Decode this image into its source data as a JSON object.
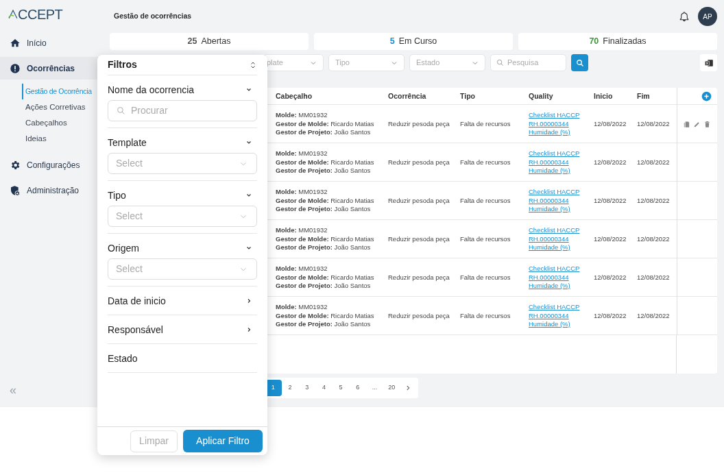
{
  "logo": "CCEPT",
  "sidebar": {
    "items": [
      {
        "label": "Início",
        "selected": false
      },
      {
        "label": "Ocorrências",
        "selected": true,
        "children": [
          {
            "label": "Gestão de Ocorrência",
            "selected": true
          },
          {
            "label": "Ações Corretivas",
            "selected": false
          },
          {
            "label": "Cabeçalhos",
            "selected": false
          },
          {
            "label": "Ideias",
            "selected": false
          }
        ]
      },
      {
        "label": "Configurações",
        "selected": false
      },
      {
        "label": "Administração",
        "selected": false
      }
    ],
    "collapse": "«"
  },
  "header": {
    "title": "Gestão de ocorrências",
    "avatar": "AP"
  },
  "status_cards": [
    {
      "count": "25",
      "label": "Abertas",
      "color": "#555555"
    },
    {
      "count": "5",
      "label": "Em Curso",
      "color": "#1a8fd0"
    },
    {
      "count": "70",
      "label": "Finalizadas",
      "color": "#3a9a3a"
    }
  ],
  "filter_bar": {
    "selects": [
      "plate",
      "Tipo",
      "Estado"
    ],
    "search_placeholder": "Pesquisa"
  },
  "table": {
    "columns": [
      "Cabeçalho",
      "Ocorrência",
      "Tipo",
      "Quality",
      "Inicio",
      "Fim"
    ],
    "rows": [
      {
        "header_lines": [
          "**Molde:** MM01932",
          "**Gestor de Molde:** Ricardo Matias",
          "**Gestor de Projeto:** João Santos"
        ],
        "occurrence": "Reduzir pesoda peça",
        "type": "Falta de recursos",
        "quality": [
          "Checklist HACCP",
          "RH.00000344",
          "Humidade (%)"
        ],
        "start": "12/08/2022",
        "end": "12/08/2022",
        "show_actions": true
      },
      {
        "header_lines": [
          "**Molde:** MM01932",
          "**Gestor de Molde:** Ricardo Matias",
          "**Gestor de Projeto:** João Santos"
        ],
        "occurrence": "Reduzir pesoda peça",
        "type": "Falta de recursos",
        "quality": [
          "Checklist HACCP",
          "RH.00000344",
          "Humidade (%)"
        ],
        "start": "12/08/2022",
        "end": "12/08/2022",
        "show_actions": false
      },
      {
        "header_lines": [
          "**Molde:** MM01932",
          "**Gestor de Molde:** Ricardo Matias",
          "**Gestor de Projeto:** João Santos"
        ],
        "occurrence": "Reduzir pesoda peça",
        "type": "Falta de recursos",
        "quality": [
          "Checklist HACCP",
          "RH.00000344",
          "Humidade (%)"
        ],
        "start": "12/08/2022",
        "end": "12/08/2022",
        "show_actions": false
      },
      {
        "header_lines": [
          "**Molde:** MM01932",
          "**Gestor de Molde:** Ricardo Matias",
          "**Gestor de Projeto:** João Santos"
        ],
        "occurrence": "Reduzir pesoda peça",
        "type": "Falta de recursos",
        "quality": [
          "Checklist HACCP",
          "RH.00000344",
          "Humidade (%)"
        ],
        "start": "12/08/2022",
        "end": "12/08/2022",
        "show_actions": false
      },
      {
        "header_lines": [
          "**Molde:** MM01932",
          "**Gestor de Molde:** Ricardo Matias",
          "**Gestor de Projeto:** João Santos"
        ],
        "occurrence": "Reduzir pesoda peça",
        "type": "Falta de recursos",
        "quality": [
          "Checklist HACCP",
          "RH.00000344",
          "Humidade (%)"
        ],
        "start": "12/08/2022",
        "end": "12/08/2022",
        "show_actions": false
      },
      {
        "header_lines": [
          "**Molde:** MM01932",
          "**Gestor de Molde:** Ricardo Matias",
          "**Gestor de Projeto:** João Santos"
        ],
        "occurrence": "Reduzir pesoda peça",
        "type": "Falta de recursos",
        "quality": [
          "Checklist HACCP",
          "RH.00000344",
          "Humidade (%)"
        ],
        "start": "12/08/2022",
        "end": "12/08/2022",
        "show_actions": false
      }
    ]
  },
  "pagination": [
    {
      "label": "1",
      "selected": true
    },
    {
      "label": "2",
      "selected": false
    },
    {
      "label": "3",
      "selected": false
    },
    {
      "label": "4",
      "selected": false
    },
    {
      "label": "5",
      "selected": false
    },
    {
      "label": "6",
      "selected": false
    },
    {
      "label": "...",
      "selected": false
    },
    {
      "label": "20",
      "selected": false
    }
  ],
  "filter_panel": {
    "title": "Filtros",
    "sections": [
      {
        "kind": "search",
        "label": "Nome da ocorrencia",
        "placeholder": "Procurar"
      },
      {
        "kind": "select",
        "label": "Template",
        "placeholder": "Select"
      },
      {
        "kind": "select",
        "label": "Tipo",
        "placeholder": "Select"
      },
      {
        "kind": "select",
        "label": "Origem",
        "placeholder": "Select"
      },
      {
        "kind": "link",
        "label": "Data de inicio"
      },
      {
        "kind": "link",
        "label": "Responsável"
      },
      {
        "kind": "plain",
        "label": "Estado"
      }
    ],
    "buttons": {
      "clear": "Limpar",
      "apply": "Aplicar Filtro"
    }
  }
}
